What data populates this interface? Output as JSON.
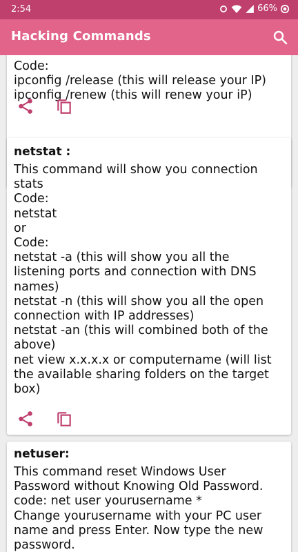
{
  "status": {
    "time": "2:54",
    "battery": "66%"
  },
  "appbar": {
    "title": "Hacking Commands",
    "search_icon": "search-icon"
  },
  "colors": {
    "primary": "#e2648a",
    "primary_dark": "#bf3f6d",
    "icon": "#bf3f6d"
  },
  "cards": [
    {
      "heading": "",
      "body": "Code:\nipconfig /release (this will release your IP)\nipconfig /renew (this will renew your iP)"
    },
    {
      "heading": "netstat :",
      "body": "This command will show you connection\nstats\nCode:\nnetstat\nor\nCode:\nnetstat -a (this will show you all the\nlistening ports and connection with DNS\nnames)\nnetstat -n (this will show you all the open\nconnection with IP addresses)\nnetstat -an (this will combined both of the\nabove)\nnet view x.x.x.x or computername (will list\nthe available sharing folders on the target\nbox)"
    },
    {
      "heading": "netuser:",
      "body": "This command reset Windows User\nPassword without Knowing Old Password.\ncode: net user yourusername *\nChange yourusername with your PC user\nname and press Enter. Now type the new\npassword."
    }
  ],
  "actions": {
    "share_icon": "share-icon",
    "copy_icon": "copy-icon"
  }
}
